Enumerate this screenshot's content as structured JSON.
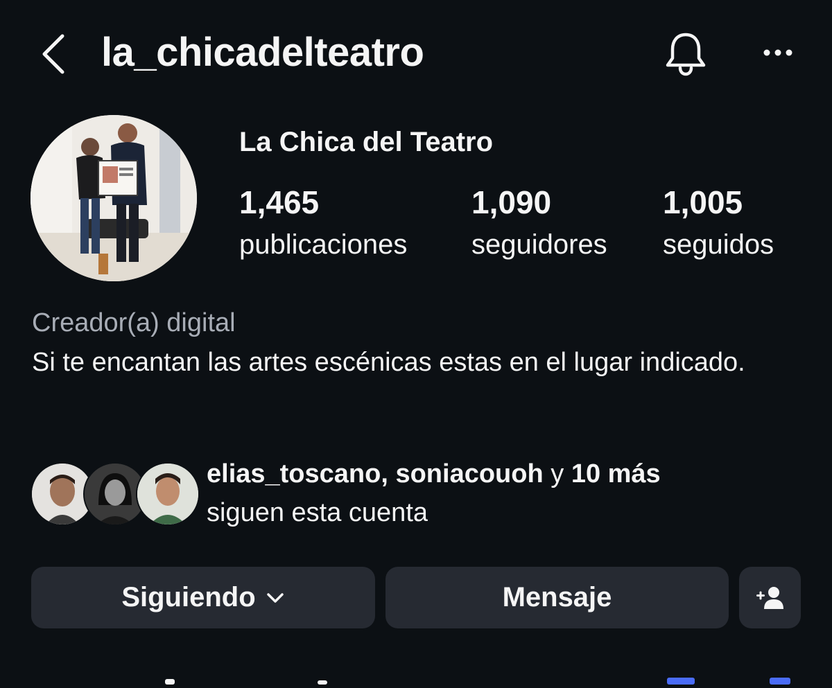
{
  "header": {
    "username": "la_chicadelteatro",
    "back_icon": "chevron-left-icon",
    "notification_icon": "bell-icon",
    "more_icon": "more-horizontal-icon"
  },
  "profile": {
    "display_name": "La Chica del Teatro",
    "category": "Creador(a) digital",
    "bio": "Si te encantan las artes escénicas estas en el lugar indicado."
  },
  "stats": [
    {
      "value": "1,465",
      "label": "publicaciones"
    },
    {
      "value": "1,090",
      "label": "seguidores"
    },
    {
      "value": "1,005",
      "label": "seguidos"
    }
  ],
  "mutual": {
    "names": "elias_toscano, soniacouoh",
    "connector": "y",
    "others": "10 más",
    "suffix": "siguen esta cuenta"
  },
  "actions": {
    "following_label": "Siguiendo",
    "message_label": "Mensaje",
    "add_user_icon": "add-user-icon"
  },
  "colors": {
    "background": "#0c1014",
    "button": "#262a32",
    "text": "#f5f5f5",
    "muted": "#a8adb6"
  }
}
